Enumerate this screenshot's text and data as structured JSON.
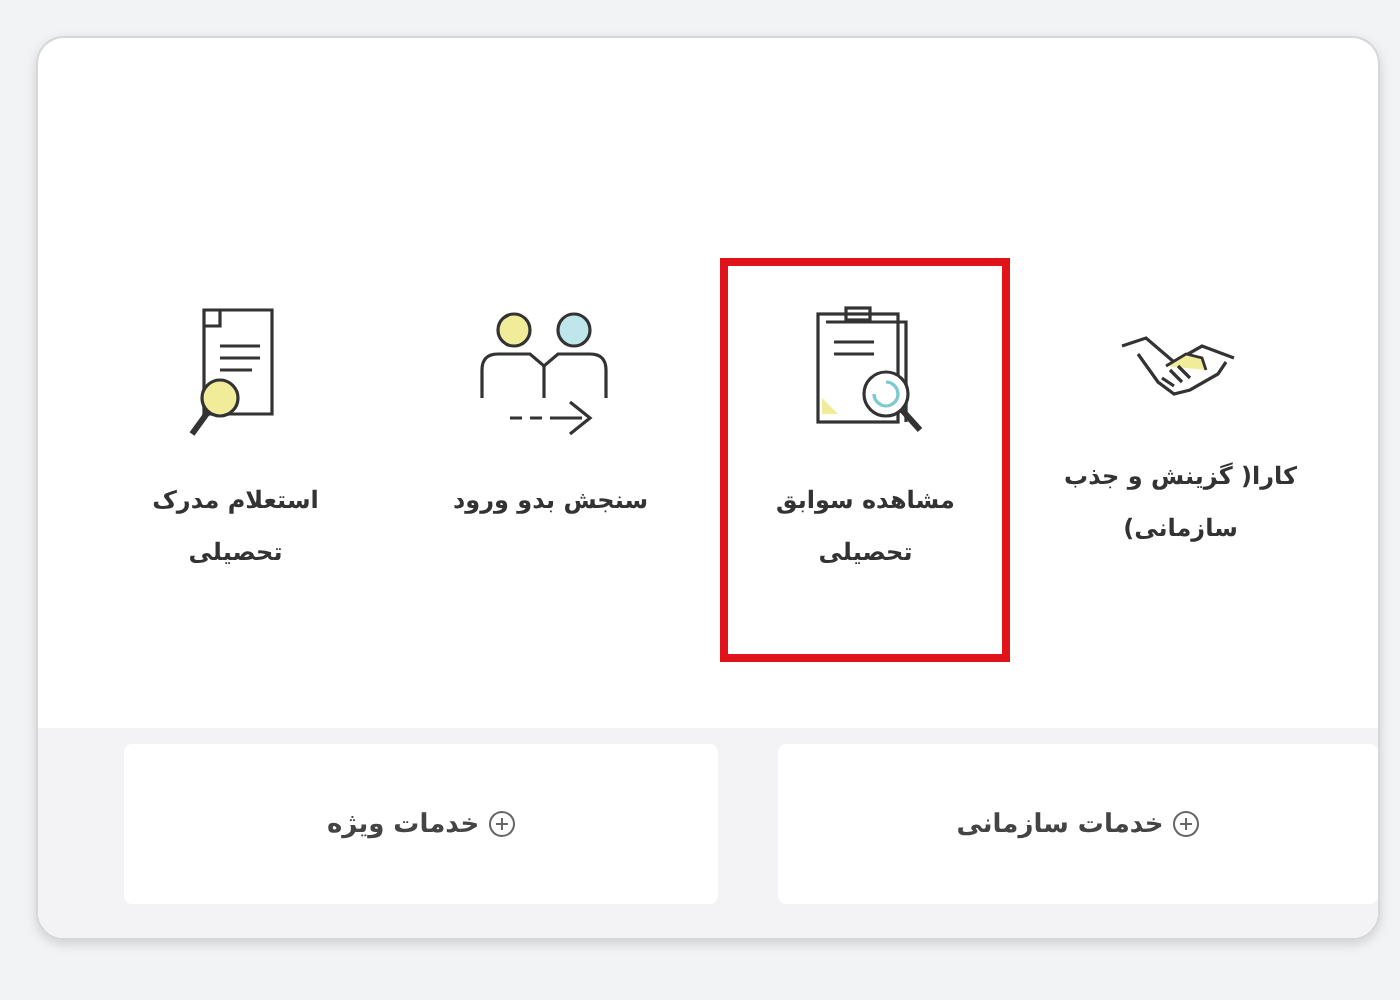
{
  "services": [
    {
      "kind": "handshake",
      "label": "کارا( گزینش و جذب سازمانی)",
      "selected": false
    },
    {
      "kind": "document-search",
      "label": "مشاهده سوابق تحصیلی",
      "selected": true
    },
    {
      "kind": "people-arrow",
      "label": "سنجش بدو ورود",
      "selected": false
    },
    {
      "kind": "certificate-search",
      "label": "استعلام مدرک تحصیلی",
      "selected": false
    }
  ],
  "sections": [
    {
      "label": "خدمات سازمانی"
    },
    {
      "label": "خدمات ویژه"
    }
  ]
}
